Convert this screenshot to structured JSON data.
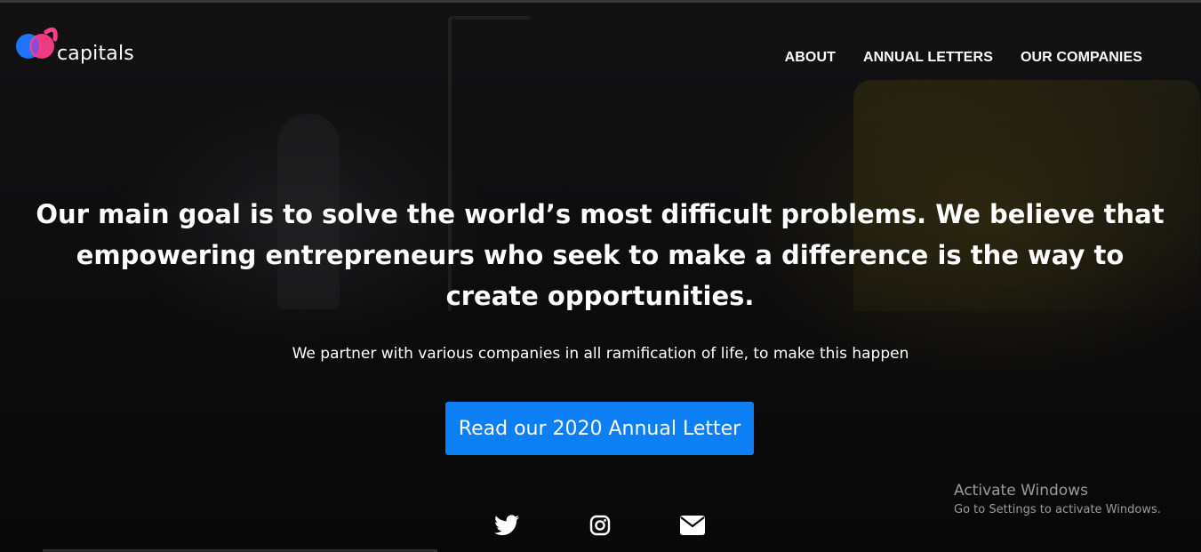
{
  "brand": {
    "name": "capitals",
    "colors": {
      "blue": "#1e73ff",
      "pink": "#ff3f8a",
      "cta": "#0d7ff5"
    }
  },
  "nav": {
    "items": [
      {
        "label": "ABOUT"
      },
      {
        "label": "ANNUAL LETTERS"
      },
      {
        "label": "OUR COMPANIES"
      }
    ]
  },
  "hero": {
    "headline": "Our main goal is to solve the world’s most difficult problems. We believe that empowering entrepreneurs who seek to make a difference is the way to create opportunities.",
    "subtext": "We partner with various companies in all ramification of life, to make this happen",
    "cta_label": "Read our 2020 Annual Letter"
  },
  "social": {
    "icons": [
      "twitter-icon",
      "instagram-icon",
      "envelope-icon"
    ]
  },
  "watermark": {
    "title": "Activate Windows",
    "subtitle": "Go to Settings to activate Windows."
  }
}
